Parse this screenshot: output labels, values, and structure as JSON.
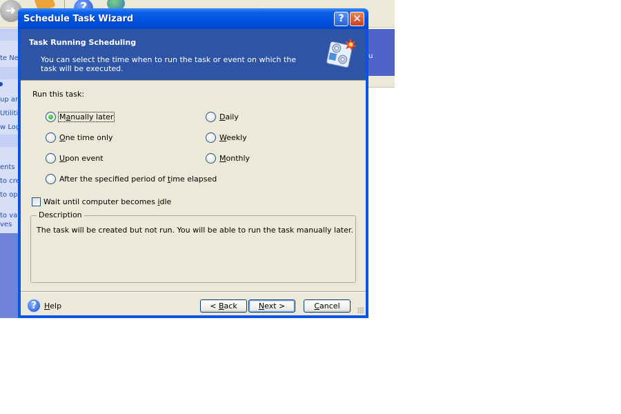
{
  "background_app": {
    "sidebar_fragments": [
      "te Ne",
      "up an",
      "Utilitie",
      "w Log",
      "ents",
      "to cre",
      "to op",
      "to va",
      "ves"
    ],
    "banner_fragment": "u"
  },
  "dialog": {
    "title": "Schedule Task Wizard",
    "caption_buttons": {
      "help": "?",
      "close": "✕"
    },
    "header": {
      "title": "Task Running Scheduling",
      "subtitle": "You can select the time when to run the task or event on which the task will be executed.",
      "icon": "scheduler-gears-icon"
    },
    "run_label": "Run this task:",
    "options": [
      {
        "id": "manually",
        "pre": "M",
        "ul": "a",
        "post": "nually later",
        "checked": true
      },
      {
        "id": "one-time",
        "pre": "",
        "ul": "O",
        "post": "ne time only",
        "checked": false
      },
      {
        "id": "upon-event",
        "pre": "",
        "ul": "U",
        "post": "pon event",
        "checked": false
      },
      {
        "id": "after-period",
        "pre": "After the specified period of ",
        "ul": "t",
        "post": "ime elapsed",
        "checked": false
      },
      {
        "id": "daily",
        "pre": "",
        "ul": "D",
        "post": "aily",
        "checked": false
      },
      {
        "id": "weekly",
        "pre": "",
        "ul": "W",
        "post": "eekly",
        "checked": false
      },
      {
        "id": "monthly",
        "pre": "",
        "ul": "M",
        "post": "onthly",
        "checked": false
      }
    ],
    "idle_checkbox": {
      "pre": "Wait until computer becomes ",
      "ul": "i",
      "post": "dle",
      "checked": false
    },
    "description": {
      "legend": "Description",
      "text": "The task will be created but not run. You will be able to run the task manually later."
    },
    "footer": {
      "help": {
        "ul": "H",
        "post": "elp"
      },
      "back": {
        "pre": "< ",
        "ul": "B",
        "post": "ack"
      },
      "next": {
        "pre": "",
        "ul": "N",
        "post": "ext >"
      },
      "cancel": {
        "pre": "",
        "ul": "C",
        "post": "ancel"
      }
    }
  },
  "colors": {
    "titlebar": "#0a54e4",
    "header_bg": "#2e55a5",
    "dialog_bg": "#ece9d8",
    "radio_checked": "#21a121"
  }
}
